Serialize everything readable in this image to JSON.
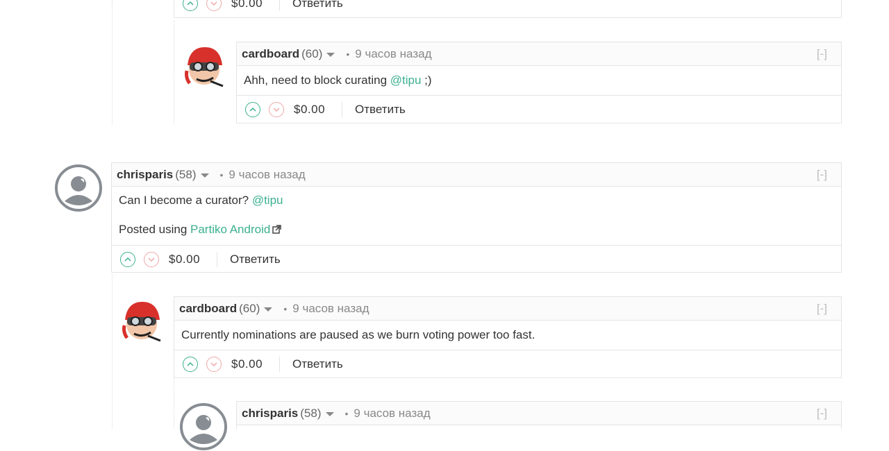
{
  "top_fragment": {
    "payout": "$0.00",
    "reply_label": "Ответить"
  },
  "comments": [
    {
      "author": "cardboard",
      "rep": "(60)",
      "time": "9 часов назад",
      "collapse": "[-]",
      "body": [
        "Ahh, need to block curating ",
        "@tipu",
        " ;)"
      ],
      "payout": "$0.00",
      "reply_label": "Ответить"
    },
    {
      "author": "chrisparis",
      "rep": "(58)",
      "time": "9 часов назад",
      "collapse": "[-]",
      "body": [
        "Can I become a curator? ",
        "@tipu"
      ],
      "body2": [
        "Posted using ",
        "Partiko Android"
      ],
      "payout": "$0.00",
      "reply_label": "Ответить"
    },
    {
      "author": "cardboard",
      "rep": "(60)",
      "time": "9 часов назад",
      "collapse": "[-]",
      "body": [
        "Currently nominations are paused as we burn voting power too fast."
      ],
      "payout": "$0.00",
      "reply_label": "Ответить"
    },
    {
      "author": "chrisparis",
      "rep": "(58)",
      "time": "9 часов назад",
      "collapse": "[-]"
    }
  ],
  "colors": {
    "accent": "#3bb08f",
    "downvote": "#f0a7a7",
    "border": "#e4e4e4"
  },
  "icons": [
    "upvote-icon",
    "downvote-icon",
    "external-link-icon",
    "avatar-cardboard",
    "avatar-default"
  ]
}
